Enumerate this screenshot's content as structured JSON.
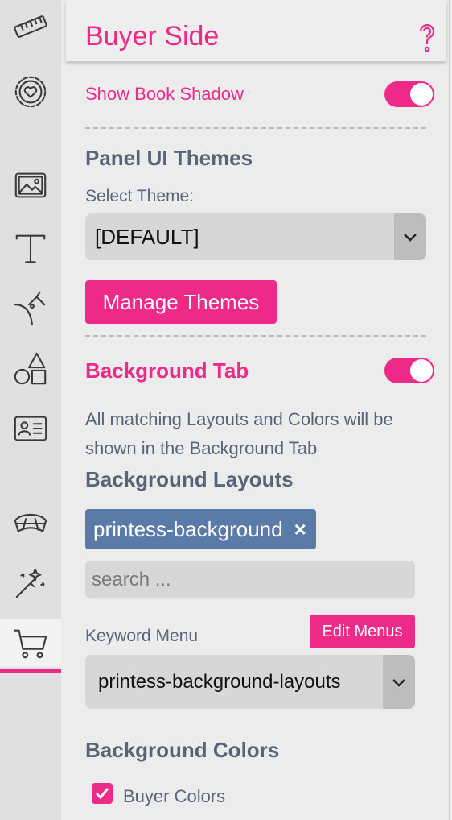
{
  "header": {
    "title": "Buyer Side",
    "help_icon": "question-mark-icon"
  },
  "rail": {
    "items": [
      {
        "icon": "ruler-icon"
      },
      {
        "icon": "heart-badge-icon"
      },
      {
        "icon": "image-icon"
      },
      {
        "icon": "text-icon"
      },
      {
        "icon": "curve-pen-icon"
      },
      {
        "icon": "shapes-icon"
      },
      {
        "icon": "id-card-icon"
      },
      {
        "icon": "paper-tray-icon"
      },
      {
        "icon": "magic-wand-icon"
      },
      {
        "icon": "cart-icon",
        "active": true
      }
    ]
  },
  "settings": {
    "show_book_shadow": {
      "label": "Show Book Shadow",
      "on": true
    },
    "panel_ui_themes": {
      "title": "Panel UI Themes",
      "select_label": "Select Theme:",
      "selected_theme": "[DEFAULT]",
      "manage_button": "Manage Themes"
    },
    "background_tab": {
      "label": "Background Tab",
      "on": true,
      "description": "All matching Layouts and Colors will be shown in the Background Tab"
    },
    "background_layouts": {
      "title": "Background Layouts",
      "chips": [
        {
          "label": "printess-background",
          "remove": "×"
        }
      ],
      "search_placeholder": "search ..."
    },
    "keyword_menu": {
      "label": "Keyword Menu",
      "edit_button": "Edit Menus",
      "selected": "printess-background-layouts"
    },
    "background_colors": {
      "title": "Background Colors",
      "buyer_colors": {
        "label": "Buyer Colors",
        "checked": true
      }
    }
  },
  "colors": {
    "accent": "#ee2a88",
    "text_slate": "#5a6478",
    "chip_blue": "#5a7aa8"
  }
}
